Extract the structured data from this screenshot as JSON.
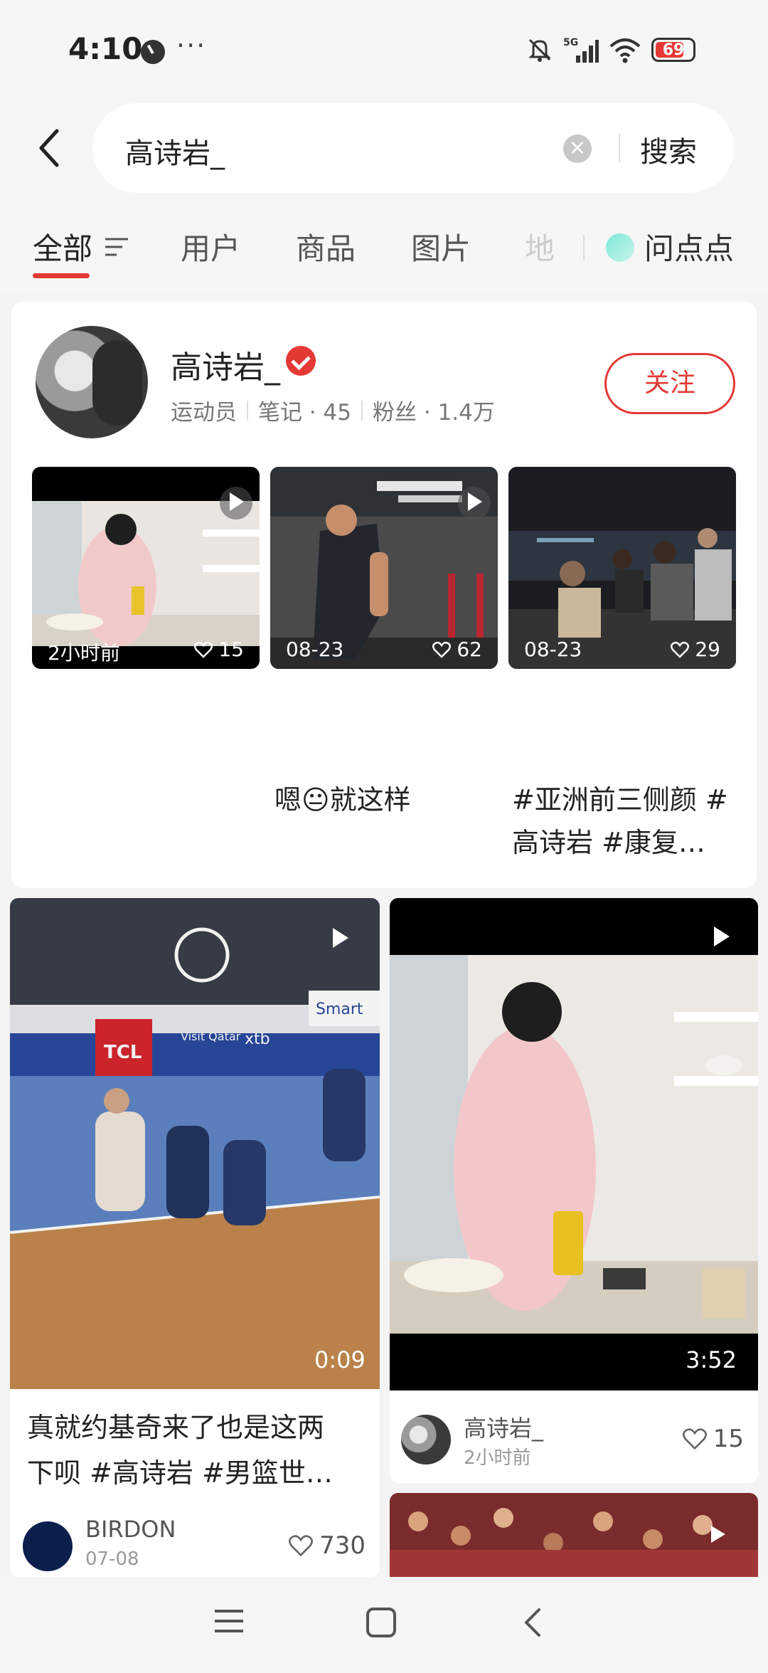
{
  "status_bar": {
    "time": "4:10",
    "more_dots": "···",
    "network": "5G",
    "battery": "69",
    "battery_color": "#e53935"
  },
  "search": {
    "query": "高诗岩_",
    "button_label": "搜索"
  },
  "tabs": {
    "items": [
      "全部",
      "用户",
      "商品",
      "图片",
      "地"
    ],
    "ask_label": "问点点",
    "accent": "#e53935"
  },
  "user_card": {
    "name": "高诗岩_",
    "role": "运动员",
    "notes_label": "笔记 · 45",
    "fans_label": "粉丝 · 1.4万",
    "follow_label": "关注",
    "thumbs": [
      {
        "date": "2小时前",
        "likes": "15",
        "caption": ""
      },
      {
        "date": "08-23",
        "likes": "62",
        "caption": "嗯😐就这样"
      },
      {
        "date": "08-23",
        "likes": "29",
        "caption_line1": "#亚洲前三侧颜 #",
        "caption_line2": "高诗岩 #康复…"
      }
    ]
  },
  "feed": {
    "left": {
      "duration": "0:09",
      "title_line1": "真就约基奇来了也是这两",
      "title_line2": "下呗 #高诗岩 #男篮世…",
      "author": "BIRDON",
      "date": "07-08",
      "likes": "730",
      "ad_texts": [
        "TCL",
        "Smart",
        "xtb",
        "Visit Qatar"
      ]
    },
    "right": {
      "duration": "3:52",
      "author": "高诗岩_",
      "time": "2小时前",
      "likes": "15"
    }
  },
  "nav": {
    "icons": [
      "menu-icon",
      "home-square-icon",
      "back-icon"
    ]
  }
}
